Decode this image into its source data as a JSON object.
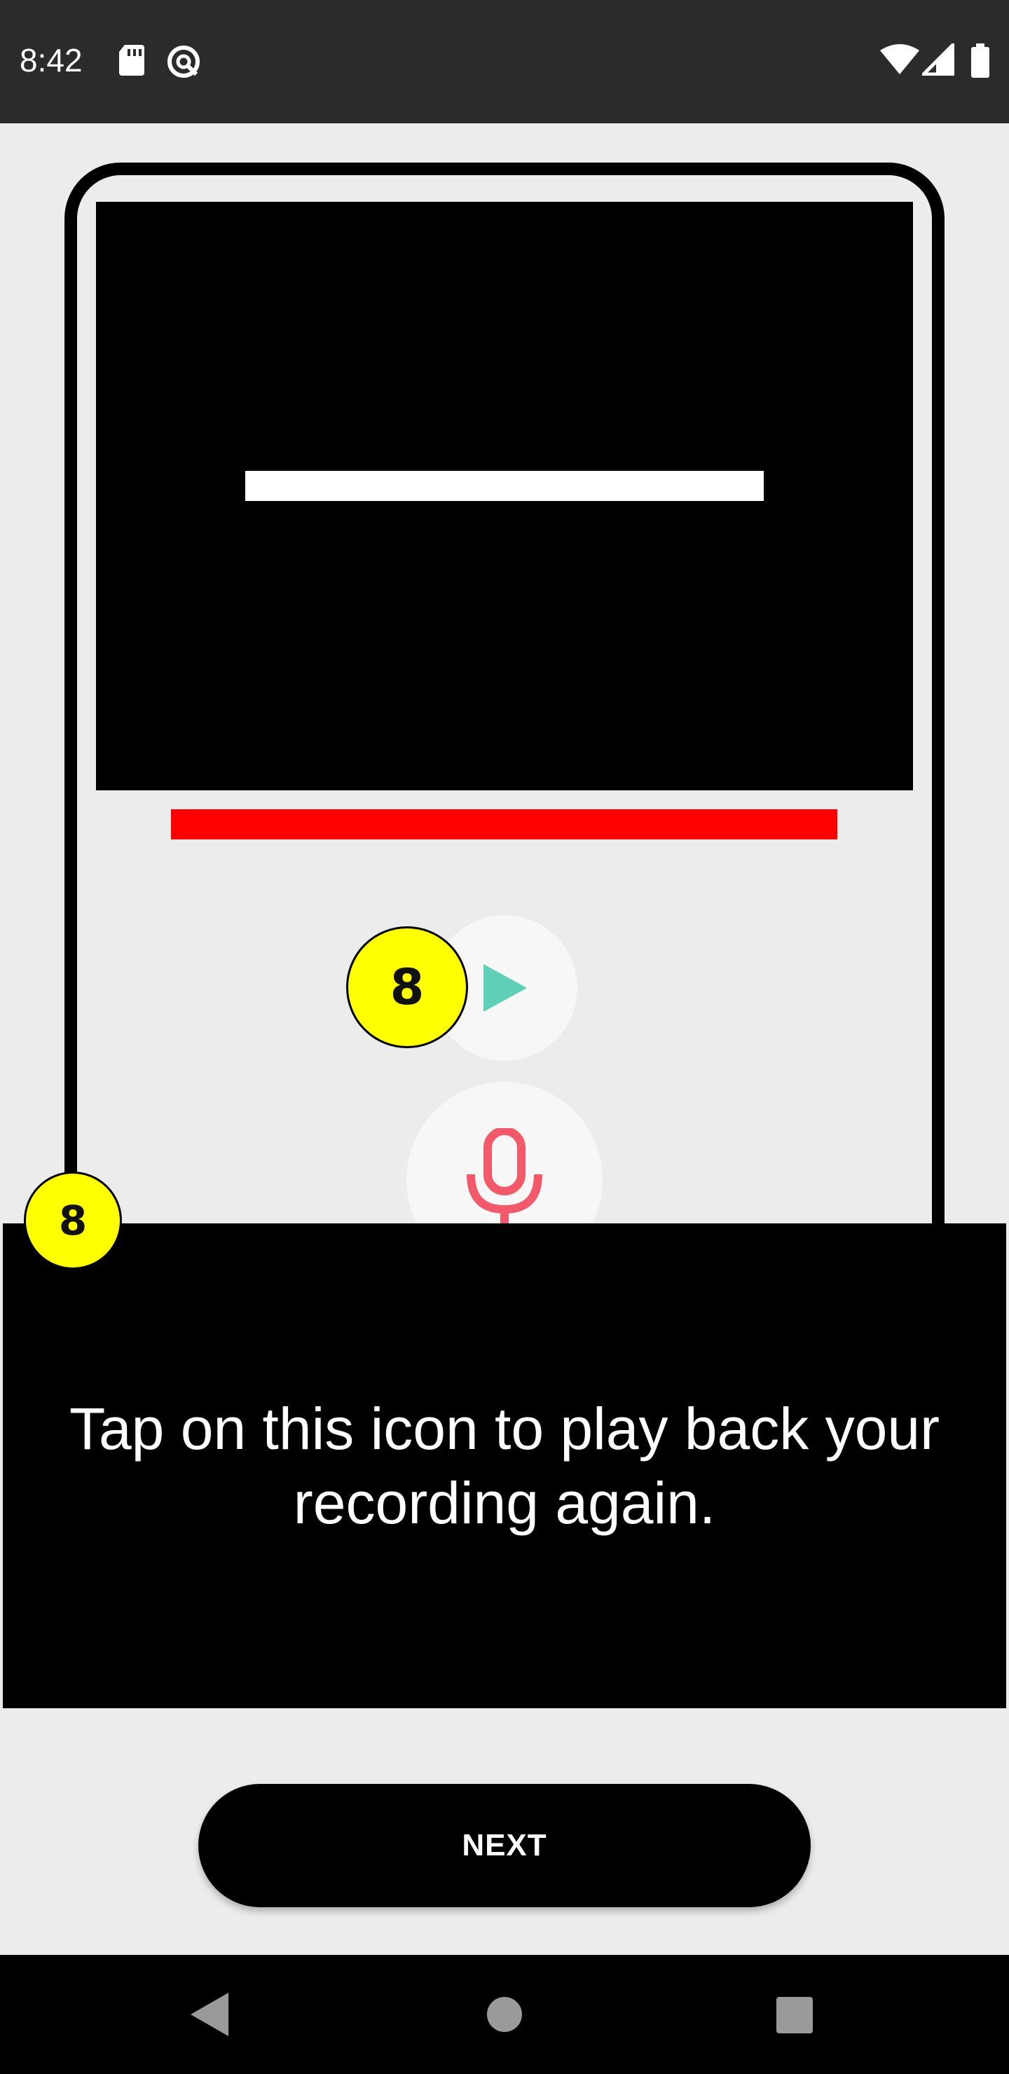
{
  "status_bar": {
    "time": "8:42",
    "icons": [
      "sd-card-icon",
      "data-saver-icon",
      "wifi-icon",
      "signal-icon",
      "battery-icon"
    ]
  },
  "illustration": {
    "play_badge_number": "8",
    "corner_badge_number": "8",
    "colors": {
      "badge": "#ffff00",
      "play_icon": "#5fcfb7",
      "mic_icon": "#f2596a",
      "progress_bar": "#ff0000"
    }
  },
  "tooltip": {
    "text": "Tap on this icon to play back your recording again."
  },
  "actions": {
    "next_label": "NEXT"
  },
  "nav_bar": {
    "icons": [
      "back-icon",
      "home-icon",
      "recents-icon"
    ]
  }
}
